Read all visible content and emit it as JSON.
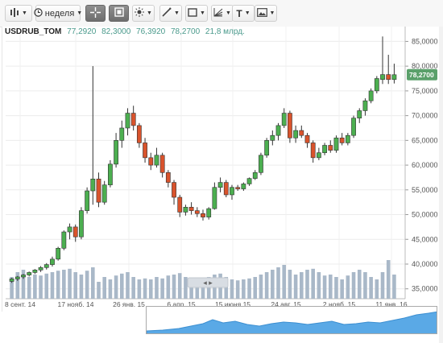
{
  "toolbar": {
    "timeframe_label": "неделя",
    "text_tool_label": "T"
  },
  "header": {
    "symbol": "USDRUB_TOM",
    "open": "77,2920",
    "high": "82,3000",
    "low": "76,3920",
    "close": "78,2700",
    "volume": "21,8 млрд."
  },
  "price_axis": {
    "labels": [
      "85,0000",
      "80,0000",
      "75,0000",
      "70,0000",
      "65,0000",
      "60,0000",
      "55,0000",
      "50,0000",
      "45,0000",
      "40,0000",
      "35,0000"
    ],
    "current_price_label": "78,2700"
  },
  "time_axis": {
    "labels": [
      "8 сент. 14",
      "17 нояб. 14",
      "26 янв. 15",
      "6 апр. 15",
      "15 июня 15",
      "24 авг. 15",
      "2 нояб. 15",
      "11 янв. 16"
    ]
  },
  "colors": {
    "up": "#4caf50",
    "down": "#d9532c",
    "volume": "#a9b8c8",
    "navigator_fill": "#5aa9e6",
    "price_badge": "#5aa06a"
  },
  "chart_data": {
    "type": "candlestick",
    "ylim": [
      33,
      88
    ],
    "x_labels": [
      "8 сент. 14",
      "17 нояб. 14",
      "26 янв. 15",
      "6 апр. 15",
      "15 июня 15",
      "24 авг. 15",
      "2 нояб. 15",
      "11 янв. 16"
    ],
    "candles": [
      [
        36.5,
        37.2,
        36.2,
        37.0
      ],
      [
        37.0,
        37.6,
        36.6,
        37.4
      ],
      [
        37.4,
        38.0,
        37.0,
        37.8
      ],
      [
        37.8,
        38.5,
        37.5,
        38.3
      ],
      [
        38.3,
        39.0,
        38.0,
        38.8
      ],
      [
        38.8,
        39.6,
        38.4,
        39.3
      ],
      [
        39.3,
        40.2,
        38.9,
        39.9
      ],
      [
        39.9,
        41.5,
        39.5,
        41.0
      ],
      [
        41.0,
        43.5,
        40.7,
        43.2
      ],
      [
        43.2,
        46.8,
        42.8,
        46.5
      ],
      [
        46.5,
        48.2,
        45.0,
        47.5
      ],
      [
        47.5,
        48.0,
        44.5,
        45.5
      ],
      [
        45.5,
        51.5,
        45.0,
        50.8
      ],
      [
        50.8,
        55.5,
        50.2,
        54.8
      ],
      [
        54.8,
        80.0,
        52.0,
        57.2
      ],
      [
        57.2,
        58.5,
        51.5,
        52.5
      ],
      [
        52.5,
        56.8,
        52.0,
        56.0
      ],
      [
        56.0,
        61.0,
        55.5,
        60.2
      ],
      [
        60.2,
        66.5,
        59.5,
        65.0
      ],
      [
        65.0,
        69.0,
        63.5,
        67.5
      ],
      [
        67.5,
        71.5,
        66.0,
        70.5
      ],
      [
        70.5,
        72.0,
        67.0,
        68.0
      ],
      [
        68.0,
        68.5,
        63.5,
        64.5
      ],
      [
        64.5,
        65.5,
        60.5,
        61.5
      ],
      [
        61.5,
        62.5,
        59.0,
        60.0
      ],
      [
        60.0,
        63.5,
        59.5,
        62.0
      ],
      [
        62.0,
        62.5,
        57.5,
        58.5
      ],
      [
        58.5,
        59.0,
        55.5,
        56.5
      ],
      [
        56.5,
        57.0,
        52.0,
        53.5
      ],
      [
        53.5,
        54.0,
        49.5,
        50.5
      ],
      [
        50.5,
        52.0,
        49.8,
        51.5
      ],
      [
        51.5,
        52.5,
        50.0,
        50.8
      ],
      [
        50.8,
        51.5,
        49.5,
        50.2
      ],
      [
        50.2,
        51.0,
        48.8,
        49.5
      ],
      [
        49.5,
        51.5,
        49.0,
        51.2
      ],
      [
        51.2,
        56.5,
        51.0,
        55.5
      ],
      [
        55.5,
        57.5,
        54.5,
        56.5
      ],
      [
        56.5,
        57.0,
        53.5,
        54.0
      ],
      [
        54.0,
        56.0,
        53.0,
        55.5
      ],
      [
        55.5,
        56.0,
        54.8,
        55.2
      ],
      [
        55.2,
        56.5,
        54.8,
        56.2
      ],
      [
        56.2,
        57.5,
        55.8,
        57.3
      ],
      [
        57.3,
        59.0,
        57.0,
        58.5
      ],
      [
        58.5,
        62.5,
        58.0,
        62.0
      ],
      [
        62.0,
        65.5,
        61.5,
        65.0
      ],
      [
        65.0,
        67.0,
        64.0,
        66.0
      ],
      [
        66.0,
        68.5,
        65.0,
        68.0
      ],
      [
        68.0,
        71.5,
        67.5,
        70.5
      ],
      [
        70.5,
        71.0,
        64.5,
        65.5
      ],
      [
        65.5,
        68.0,
        64.5,
        67.0
      ],
      [
        67.0,
        68.0,
        65.5,
        66.0
      ],
      [
        66.0,
        66.5,
        63.5,
        64.5
      ],
      [
        64.5,
        65.0,
        60.5,
        61.5
      ],
      [
        61.5,
        63.5,
        61.0,
        62.5
      ],
      [
        62.5,
        64.5,
        62.0,
        64.0
      ],
      [
        64.0,
        65.0,
        62.5,
        63.0
      ],
      [
        63.0,
        66.0,
        62.5,
        65.5
      ],
      [
        65.5,
        66.5,
        64.0,
        64.5
      ],
      [
        64.5,
        66.5,
        64.0,
        66.0
      ],
      [
        66.0,
        70.0,
        65.5,
        69.5
      ],
      [
        69.5,
        71.5,
        68.5,
        71.0
      ],
      [
        71.0,
        73.5,
        70.0,
        73.0
      ],
      [
        73.0,
        75.5,
        72.5,
        75.0
      ],
      [
        75.0,
        78.0,
        74.5,
        77.5
      ],
      [
        77.3,
        86.0,
        76.4,
        78.3
      ],
      [
        78.3,
        82.3,
        76.4,
        77.3
      ],
      [
        77.3,
        80.5,
        76.5,
        78.27
      ]
    ],
    "volume_ylim": [
      34,
      44
    ],
    "volumes": [
      38.5,
      39.5,
      40.0,
      38.5,
      39.0,
      38.8,
      39.2,
      39.5,
      39.8,
      40.0,
      40.2,
      39.5,
      39.0,
      39.8,
      40.5,
      37.5,
      38.5,
      38.0,
      38.8,
      39.2,
      39.5,
      38.5,
      38.0,
      38.2,
      38.0,
      38.5,
      38.2,
      38.8,
      39.0,
      39.3,
      38.5,
      38.2,
      38.0,
      37.8,
      38.5,
      39.0,
      39.2,
      38.5,
      38.0,
      37.8,
      38.0,
      38.2,
      38.5,
      39.0,
      39.5,
      40.0,
      40.5,
      41.0,
      40.0,
      39.0,
      39.5,
      40.0,
      40.2,
      39.5,
      38.8,
      39.0,
      38.5,
      38.0,
      38.8,
      39.5,
      40.0,
      39.5,
      38.5,
      38.0,
      39.5,
      42.0,
      39.0
    ]
  }
}
